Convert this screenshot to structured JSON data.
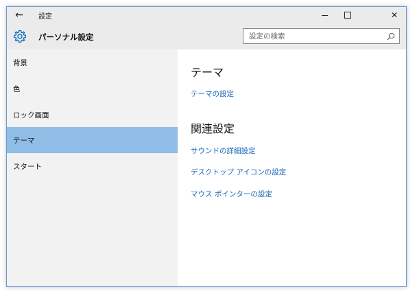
{
  "window": {
    "title": "設定",
    "back_glyph": "←",
    "close_glyph": "✕"
  },
  "header": {
    "title": "パーソナル設定",
    "icon": "gear-icon"
  },
  "search": {
    "placeholder": "設定の検索",
    "value": ""
  },
  "sidebar": {
    "items": [
      {
        "label": "背景",
        "selected": false
      },
      {
        "label": "色",
        "selected": false
      },
      {
        "label": "ロック画面",
        "selected": false
      },
      {
        "label": "テーマ",
        "selected": true
      },
      {
        "label": "スタート",
        "selected": false
      }
    ]
  },
  "content": {
    "section1_title": "テーマ",
    "section1_links": [
      "テーマの設定"
    ],
    "section2_title": "関連設定",
    "section2_links": [
      "サウンドの詳細設定",
      "デスクトップ アイコンの設定",
      "マウス ポインターの設定"
    ]
  },
  "colors": {
    "accent": "#0067c0",
    "selected_bg": "#8fbde6",
    "link": "#1565b8"
  }
}
